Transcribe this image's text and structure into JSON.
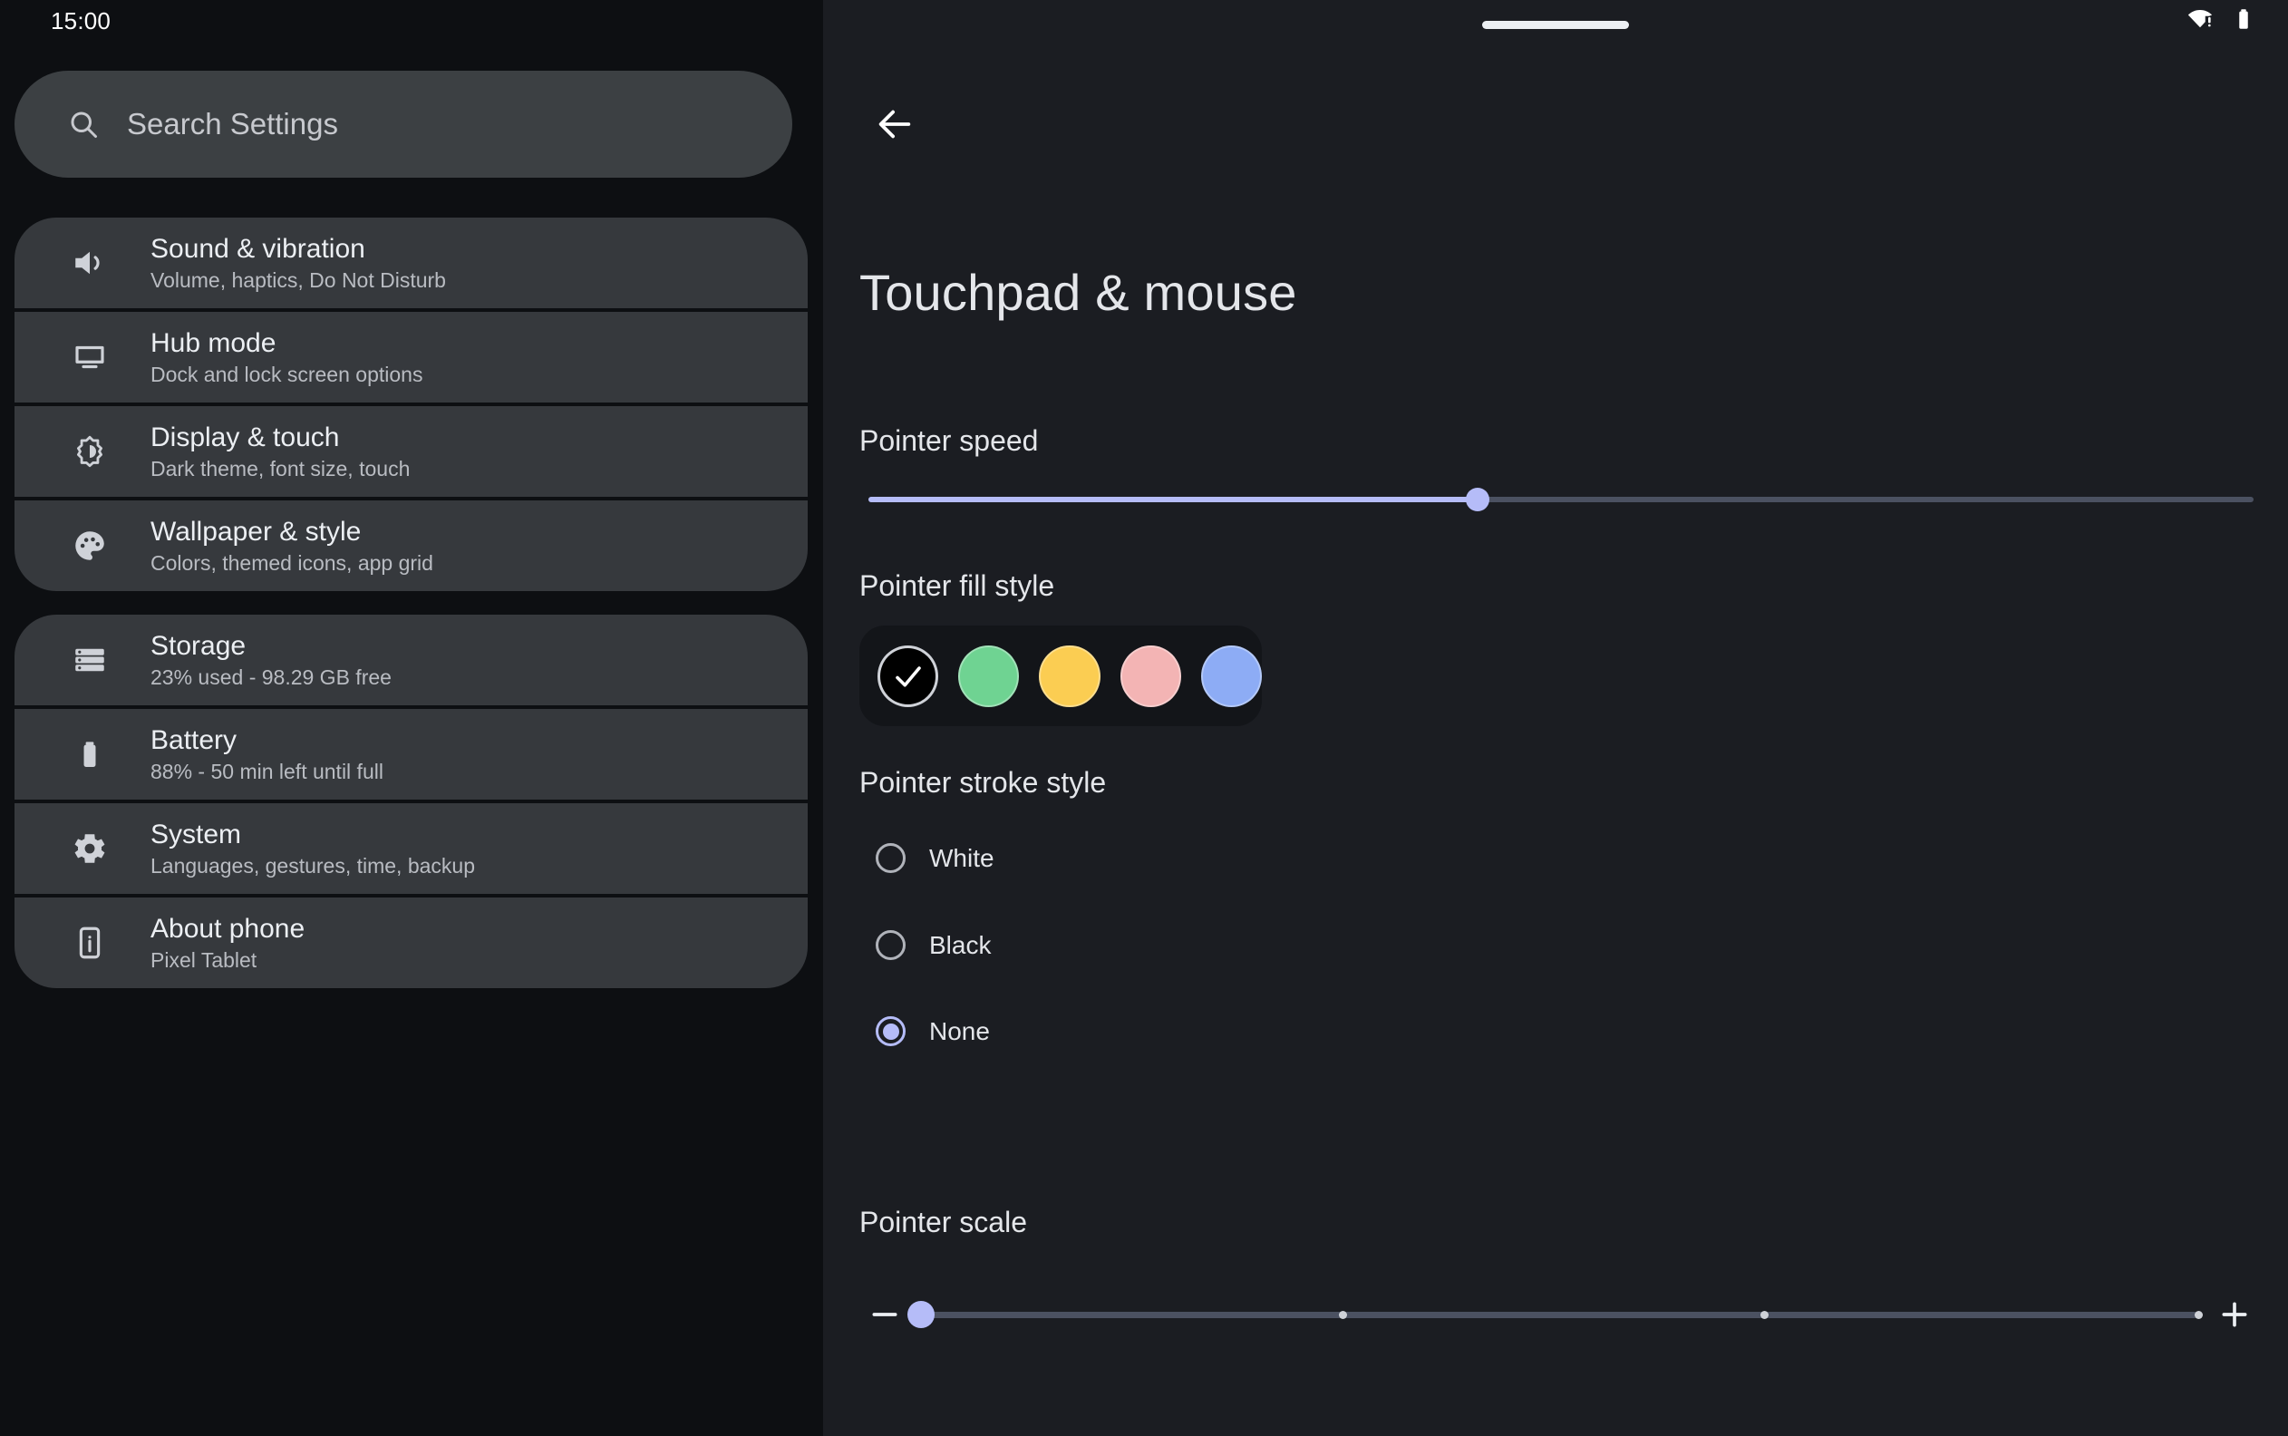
{
  "status_bar": {
    "clock": "15:00",
    "wifi_icon": "wifi-alert-icon",
    "battery_icon": "battery-icon"
  },
  "sidebar": {
    "search": {
      "placeholder": "Search Settings",
      "value": "",
      "icon": "search-icon"
    },
    "groups": [
      {
        "items": [
          {
            "icon": "volume-icon",
            "title": "Sound & vibration",
            "subtitle": "Volume, haptics, Do Not Disturb"
          },
          {
            "icon": "monitor-icon",
            "title": "Hub mode",
            "subtitle": "Dock and lock screen options"
          },
          {
            "icon": "brightness-icon",
            "title": "Display & touch",
            "subtitle": "Dark theme, font size, touch"
          },
          {
            "icon": "palette-icon",
            "title": "Wallpaper & style",
            "subtitle": "Colors, themed icons, app grid"
          }
        ]
      },
      {
        "items": [
          {
            "icon": "storage-icon",
            "title": "Storage",
            "subtitle": "23% used - 98.29 GB free"
          },
          {
            "icon": "battery-icon",
            "title": "Battery",
            "subtitle": "88% - 50 min left until full"
          },
          {
            "icon": "gear-icon",
            "title": "System",
            "subtitle": "Languages, gestures, time, backup"
          },
          {
            "icon": "phone-info-icon",
            "title": "About phone",
            "subtitle": "Pixel Tablet"
          }
        ]
      }
    ]
  },
  "detail": {
    "back_icon": "back-arrow-icon",
    "title": "Touchpad & mouse",
    "pointer_speed": {
      "label": "Pointer speed",
      "value_percent": 44,
      "min": 0,
      "max": 100,
      "accent": "#b5bcf8",
      "track": "#4b5161"
    },
    "pointer_fill_style": {
      "label": "Pointer fill style",
      "selected_index": 0,
      "options": [
        {
          "name": "black",
          "color": "#000000",
          "selected": true,
          "check_icon": "check-icon"
        },
        {
          "name": "green",
          "color": "#6fd392",
          "selected": false
        },
        {
          "name": "yellow",
          "color": "#fbcd52",
          "selected": false
        },
        {
          "name": "pink",
          "color": "#f3b4b4",
          "selected": false
        },
        {
          "name": "blue",
          "color": "#8dacf5",
          "selected": false
        }
      ]
    },
    "pointer_stroke_style": {
      "label": "Pointer stroke style",
      "selected": "None",
      "options": [
        {
          "label": "White",
          "checked": false
        },
        {
          "label": "Black",
          "checked": false
        },
        {
          "label": "None",
          "checked": true
        }
      ]
    },
    "pointer_scale": {
      "label": "Pointer scale",
      "decrease_icon": "minus-icon",
      "increase_icon": "plus-icon",
      "value_index": 0,
      "ticks": [
        0,
        33,
        66,
        100
      ],
      "accent": "#b5bcf8"
    }
  }
}
